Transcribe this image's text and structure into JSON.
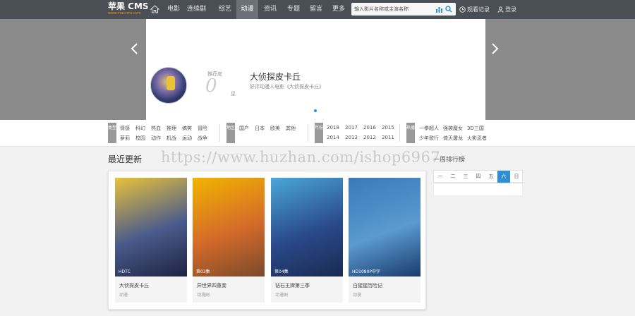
{
  "header": {
    "logo": "苹果 CMS",
    "logo_sub": "www.maccms.com",
    "nav": [
      {
        "label": "电影"
      },
      {
        "label": "连续剧"
      },
      {
        "label": "综艺"
      },
      {
        "label": "动漫",
        "active": true
      },
      {
        "label": "资讯"
      },
      {
        "label": "专题"
      },
      {
        "label": "留言"
      },
      {
        "label": "更多"
      }
    ],
    "search_placeholder": "输入影片名称或主演名称",
    "history_label": "观看记录",
    "login_label": "登录"
  },
  "banner": {
    "rating_label": "推荐度",
    "rating_score": "0",
    "rating_unit": "星",
    "title": "大侦探皮卡丘",
    "subtitle": "好评动漫人电影《大侦探皮卡丘》"
  },
  "filters": {
    "type": {
      "tag": "类型",
      "items": [
        "情感",
        "科幻",
        "热血",
        "推理",
        "搞笑",
        "冒险",
        "萝莉",
        "校园",
        "动作",
        "机战",
        "运动",
        "战争"
      ]
    },
    "region": {
      "tag": "地区",
      "items": [
        "国产",
        "日本",
        "欧美",
        "其他"
      ]
    },
    "year": {
      "tag": "年份",
      "items": [
        "2018",
        "2017",
        "2016",
        "2015",
        "2014",
        "2013",
        "2012",
        "2011"
      ]
    },
    "hot": {
      "tag": "热播",
      "items": [
        "一拳超人",
        "强袭魔女",
        "3D三国",
        "少年歌行",
        "倚天屠龙",
        "火影忍者"
      ]
    }
  },
  "recent": {
    "title": "最近更新",
    "watermark": "https://www.huzhan.com/ishop6967",
    "movies": [
      {
        "title": "大侦探皮卡丘",
        "badge": "HDTC",
        "meta": "动漫",
        "colors": [
          "#e8c23a",
          "#4a5a8c",
          "#1e2440"
        ]
      },
      {
        "title": "异世界四重奏",
        "badge": "第03集",
        "meta": "动漫剧",
        "colors": [
          "#f2b400",
          "#d46a2a",
          "#7a4a2a"
        ]
      },
      {
        "title": "钻石王牌第三季",
        "badge": "第04集",
        "meta": "动漫剧",
        "colors": [
          "#4aa8d8",
          "#2a4a8c",
          "#1a2a50"
        ]
      },
      {
        "title": "白猩猩历险记",
        "badge": "HD1080P中字",
        "meta": "动漫",
        "colors": [
          "#3a7ab8",
          "#5a9ad0",
          "#1a3a6a"
        ]
      }
    ]
  },
  "rank": {
    "title": "一周排行榜",
    "tabs": [
      "一",
      "二",
      "三",
      "四",
      "五",
      "六",
      "日"
    ],
    "active_index": 5
  }
}
